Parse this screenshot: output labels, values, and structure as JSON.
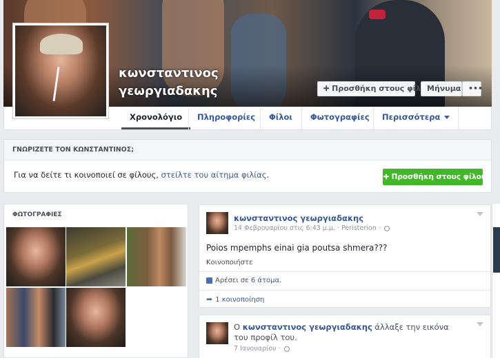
{
  "profile": {
    "name_line1": "κωνσταντινος",
    "name_line2": "γεωργιαδακης"
  },
  "cover_actions": {
    "add_friend": "Προσθήκη στους φίλους",
    "message": "Μήνυμα",
    "more": "•••"
  },
  "nav": {
    "tabs": [
      {
        "label": "Χρονολόγιο"
      },
      {
        "label": "Πληροφορίες"
      },
      {
        "label": "Φίλοι"
      },
      {
        "label": "Φωτογραφίες"
      },
      {
        "label": "Περισσότερα"
      }
    ]
  },
  "know_card": {
    "title": "ΓΝΩΡΙΖΕΤΕ ΤΟΝ ΚΩΝΣΤΑΝΤΙΝΟΣ;",
    "text_prefix": "Για να δείτε τι κοινοποιεί σε φίλους, ",
    "text_link": "στείλτε του αίτημα φιλίας",
    "text_suffix": ".",
    "button": "Προσθήκη στους φίλους"
  },
  "photos": {
    "title": "ΦΩΤΟΓΡΑΦΙΕΣ"
  },
  "posts": [
    {
      "author": "κωνσταντινος γεωργιαδακης",
      "date": "14 Φεβρουαρίου στις 6:43 μ.μ.",
      "location": "Peristerion",
      "text": "Poios mpemphs einai gia poutsa shmera???",
      "share_link": "Κοινοποιήστε",
      "likes_prefix": "Αρέσει σε ",
      "likes_link": "6 άτομα",
      "likes_suffix": ".",
      "shares": "1 κοινοποίηση"
    },
    {
      "prefix": "Ο ",
      "author": "κωνσταντινος γεωργιαδακης",
      "action": " άλλαξε την εικόνα του προφίλ του.",
      "date": "7 Ιανουαρίου"
    }
  ]
}
